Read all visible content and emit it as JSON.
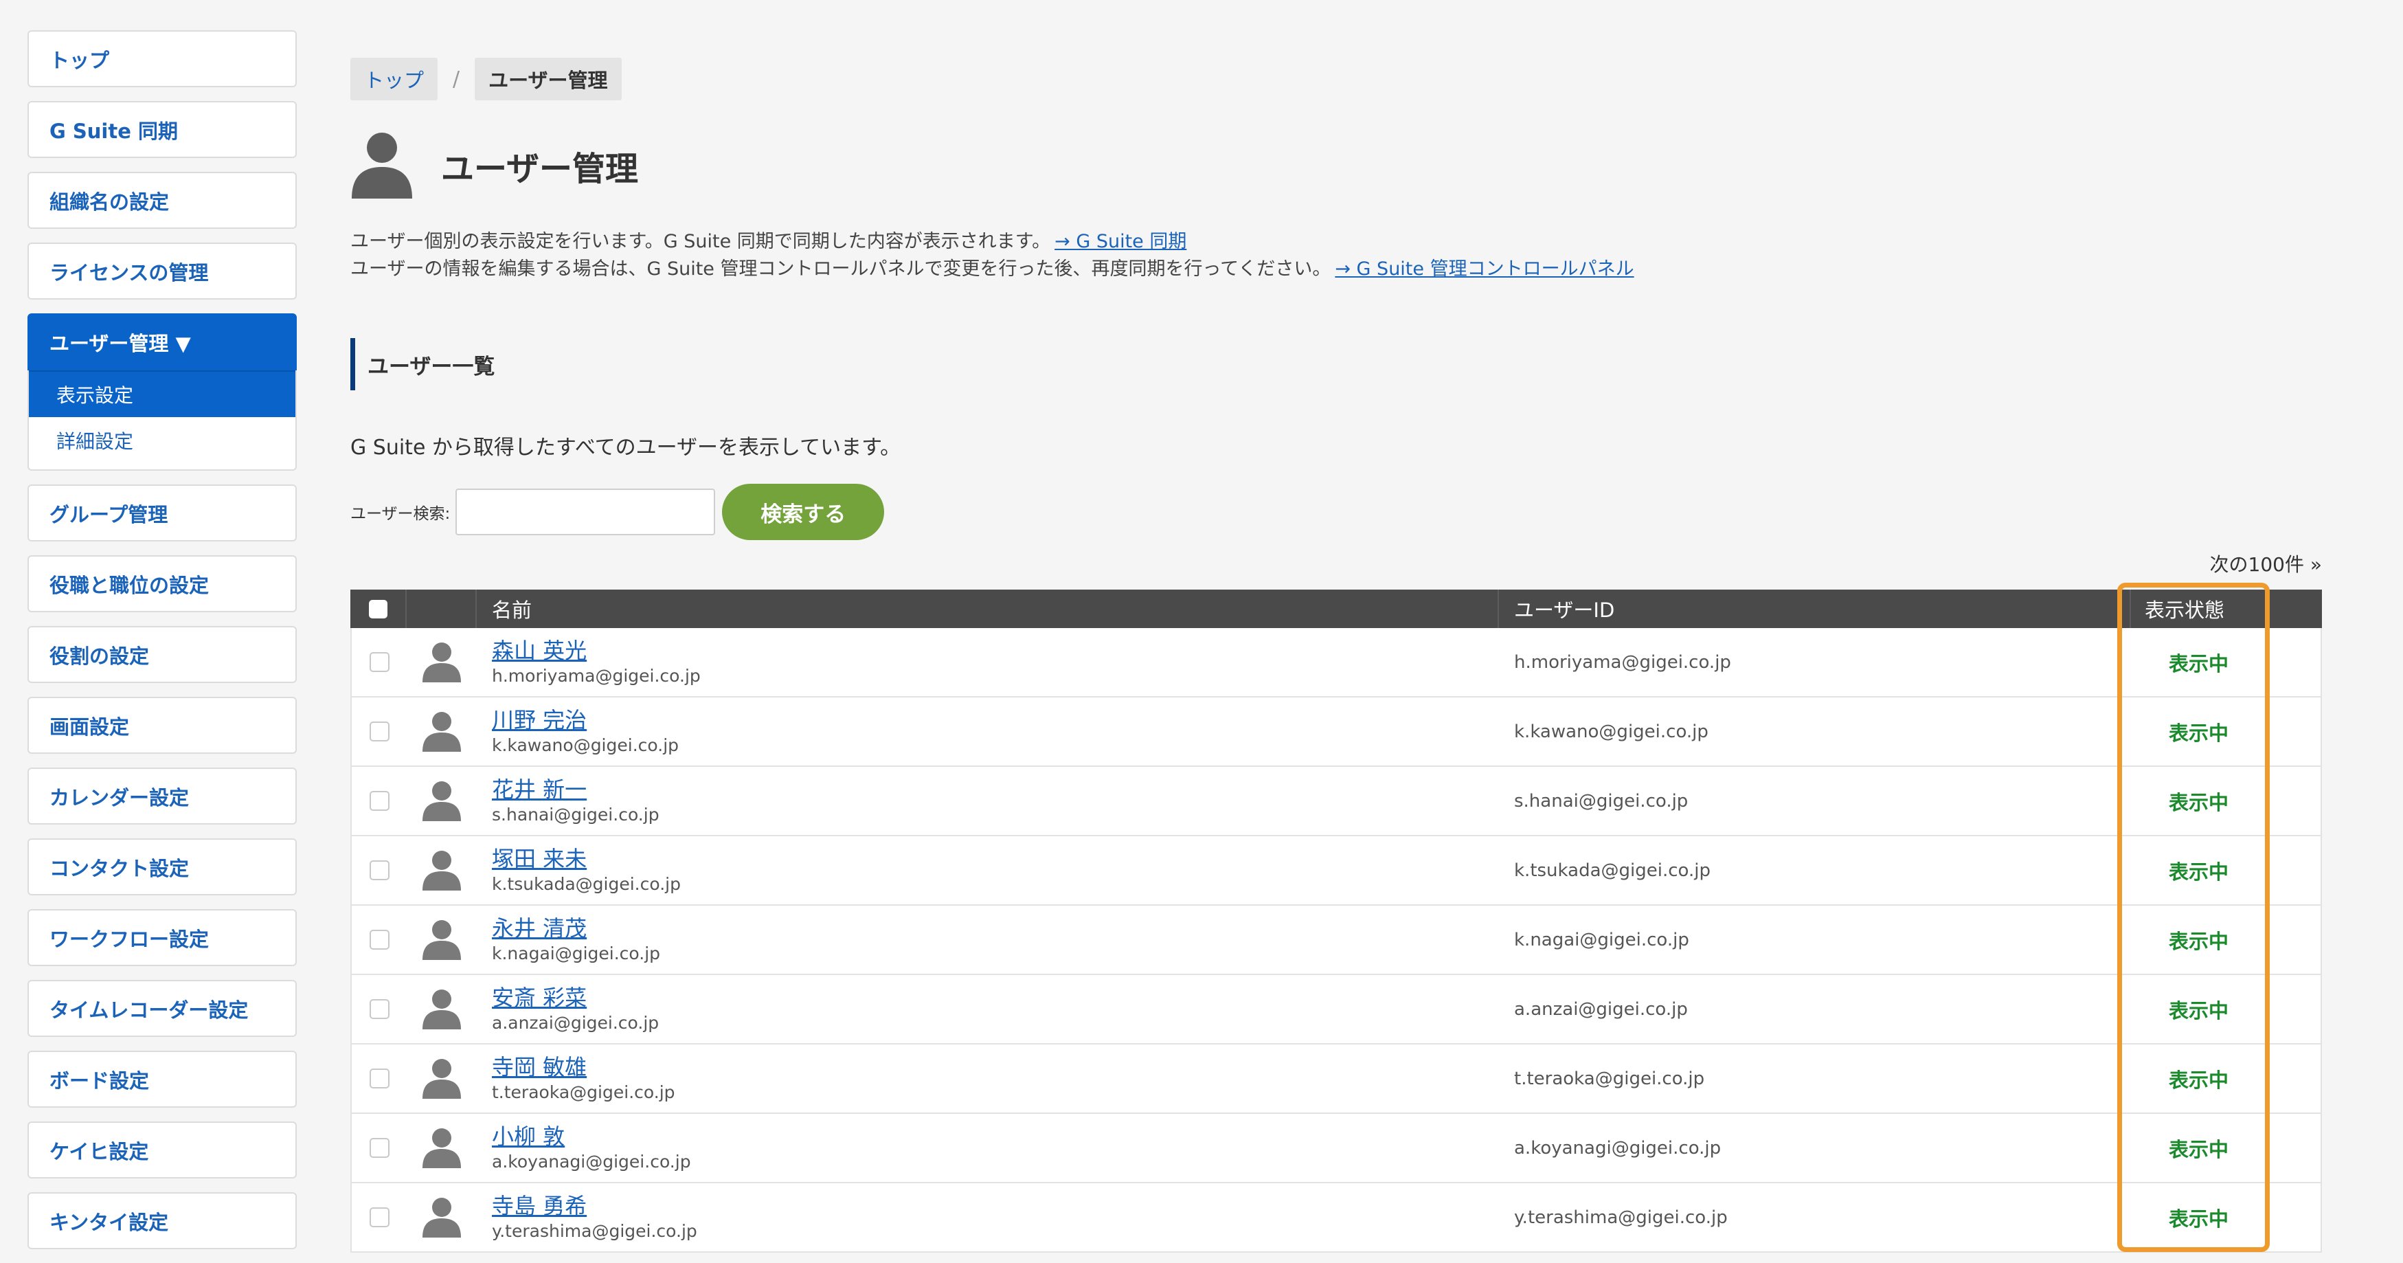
{
  "sidebar": {
    "items_top": [
      "トップ",
      "G Suite 同期",
      "組織名の設定",
      "ライセンスの管理"
    ],
    "active": "ユーザー管理 ▼",
    "sub_items": [
      "表示設定",
      "詳細設定"
    ],
    "items_bottom": [
      "グループ管理",
      "役職と職位の設定",
      "役割の設定",
      "画面設定",
      "カレンダー設定",
      "コンタクト設定",
      "ワークフロー設定",
      "タイムレコーダー設定",
      "ボード設定",
      "ケイヒ設定",
      "キンタイ設定"
    ]
  },
  "breadcrumb": {
    "top": "トップ",
    "sep": "/",
    "current": "ユーザー管理"
  },
  "page_title": "ユーザー管理",
  "desc": {
    "line1": "ユーザー個別の表示設定を行います。G Suite 同期で同期した内容が表示されます。",
    "link1": "→ G Suite 同期",
    "line2": "ユーザーの情報を編集する場合は、G Suite 管理コントロールパネルで変更を行った後、再度同期を行ってください。",
    "link2": "→ G Suite 管理コントロールパネル"
  },
  "section_title": "ユーザー一覧",
  "intro": "G Suite から取得したすべてのユーザーを表示しています。",
  "search": {
    "label": "ユーザー検索:",
    "value": "",
    "button": "検索する"
  },
  "pager_next": "次の100件 »",
  "table": {
    "headers": {
      "name": "名前",
      "uid": "ユーザーID",
      "status": "表示状態"
    },
    "rows": [
      {
        "name": "森山 英光",
        "email": "h.moriyama@gigei.co.jp",
        "uid": "h.moriyama@gigei.co.jp",
        "status": "表示中"
      },
      {
        "name": "川野 完治",
        "email": "k.kawano@gigei.co.jp",
        "uid": "k.kawano@gigei.co.jp",
        "status": "表示中"
      },
      {
        "name": "花井 新一",
        "email": "s.hanai@gigei.co.jp",
        "uid": "s.hanai@gigei.co.jp",
        "status": "表示中"
      },
      {
        "name": "塚田 来未",
        "email": "k.tsukada@gigei.co.jp",
        "uid": "k.tsukada@gigei.co.jp",
        "status": "表示中"
      },
      {
        "name": "永井 清茂",
        "email": "k.nagai@gigei.co.jp",
        "uid": "k.nagai@gigei.co.jp",
        "status": "表示中"
      },
      {
        "name": "安斎 彩菜",
        "email": "a.anzai@gigei.co.jp",
        "uid": "a.anzai@gigei.co.jp",
        "status": "表示中"
      },
      {
        "name": "寺岡 敏雄",
        "email": "t.teraoka@gigei.co.jp",
        "uid": "t.teraoka@gigei.co.jp",
        "status": "表示中"
      },
      {
        "name": "小柳 敦",
        "email": "a.koyanagi@gigei.co.jp",
        "uid": "a.koyanagi@gigei.co.jp",
        "status": "表示中"
      },
      {
        "name": "寺島 勇希",
        "email": "y.terashima@gigei.co.jp",
        "uid": "y.terashima@gigei.co.jp",
        "status": "表示中"
      }
    ]
  },
  "colors": {
    "accent": "#0a63c9",
    "button_green": "#73a33a",
    "status_green": "#1a8a2c",
    "highlight": "#ee9a2c"
  },
  "icons": {
    "page_icon": "user-silhouette-icon",
    "row_icon": "avatar-icon"
  }
}
